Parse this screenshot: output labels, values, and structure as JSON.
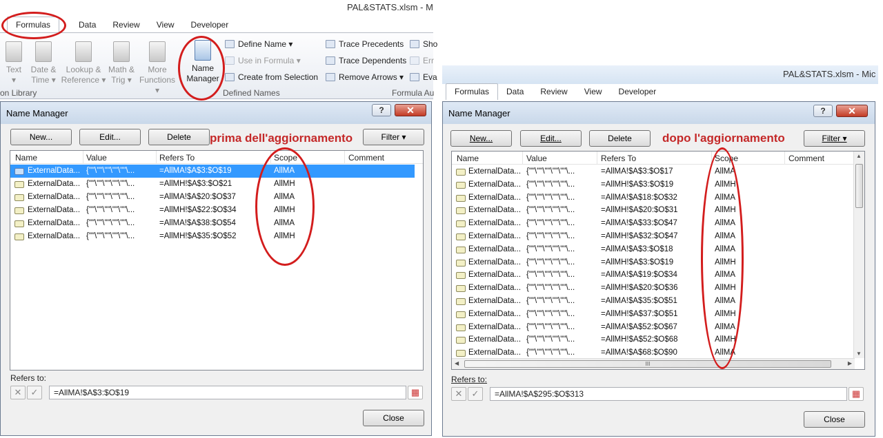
{
  "left": {
    "window_title": "PAL&STATS.xlsm - M",
    "tabs": [
      "Formulas",
      "Data",
      "Review",
      "View",
      "Developer"
    ],
    "ribbon": {
      "function_library": [
        {
          "l1": "Text",
          "l2": "▾"
        },
        {
          "l1": "Date &",
          "l2": "Time ▾"
        },
        {
          "l1": "Lookup &",
          "l2": "Reference ▾"
        },
        {
          "l1": "Math &",
          "l2": "Trig ▾"
        },
        {
          "l1": "More",
          "l2": "Functions ▾"
        }
      ],
      "function_library_label": "on Library",
      "name_manager_l1": "Name",
      "name_manager_l2": "Manager",
      "define_name": "Define Name ▾",
      "use_in_formula": "Use in Formula ▾",
      "create_from_selection": "Create from Selection",
      "defined_names_label": "Defined Names",
      "trace_precedents": "Trace Precedents",
      "trace_dependents": "Trace Dependents",
      "remove_arrows": "Remove Arrows ▾",
      "show": "Sho",
      "error": "Err",
      "evaluate": "Eva",
      "formula_auditing_label": "Formula Au"
    },
    "dialog": {
      "title": "Name Manager",
      "help": "?",
      "close_x": "✕",
      "new": "New...",
      "edit": "Edit...",
      "delete": "Delete",
      "filter": "Filter ▾",
      "annotation": "prima dell'aggiornamento",
      "columns": [
        "Name",
        "Value",
        "Refers To",
        "Scope",
        "Comment"
      ],
      "rows": [
        {
          "name": "ExternalData...",
          "value": "{\"\"\\\"\"\\\"\"\\\"\"\\\"\"\\...",
          "refers": "=AllMA!$A$3:$O$19",
          "scope": "AllMA"
        },
        {
          "name": "ExternalData...",
          "value": "{\"\"\\\"\"\\\"\"\\\"\"\\\"\"\\...",
          "refers": "=AllMH!$A$3:$O$21",
          "scope": "AllMH"
        },
        {
          "name": "ExternalData...",
          "value": "{\"\"\\\"\"\\\"\"\\\"\"\\\"\"\\...",
          "refers": "=AllMA!$A$20:$O$37",
          "scope": "AllMA"
        },
        {
          "name": "ExternalData...",
          "value": "{\"\"\\\"\"\\\"\"\\\"\"\\\"\"\\...",
          "refers": "=AllMH!$A$22:$O$34",
          "scope": "AllMH"
        },
        {
          "name": "ExternalData...",
          "value": "{\"\"\\\"\"\\\"\"\\\"\"\\\"\"\\...",
          "refers": "=AllMA!$A$38:$O$54",
          "scope": "AllMA"
        },
        {
          "name": "ExternalData...",
          "value": "{\"\"\\\"\"\\\"\"\\\"\"\\\"\"\\...",
          "refers": "=AllMH!$A$35:$O$52",
          "scope": "AllMH"
        }
      ],
      "refers_to_label": "Refers to:",
      "refers_to_value": "=AllMA!$A$3:$O$19",
      "close_button": "Close"
    }
  },
  "right": {
    "window_title": "PAL&STATS.xlsm - Mic",
    "tabs": [
      "Formulas",
      "Data",
      "Review",
      "View",
      "Developer"
    ],
    "dialog": {
      "title": "Name Manager",
      "help": "?",
      "close_x": "✕",
      "new": "New...",
      "edit": "Edit...",
      "delete": "Delete",
      "filter": "Filter ▾",
      "annotation": "dopo l'aggiornamento",
      "columns": [
        "Name",
        "Value",
        "Refers To",
        "Scope",
        "Comment"
      ],
      "rows": [
        {
          "name": "ExternalData...",
          "value": "{\"\"\\\"\"\\\"\"\\\"\"\\\"\"\\...",
          "refers": "=AllMA!$A$3:$O$17",
          "scope": "AllMA"
        },
        {
          "name": "ExternalData...",
          "value": "{\"\"\\\"\"\\\"\"\\\"\"\\\"\"\\...",
          "refers": "=AllMH!$A$3:$O$19",
          "scope": "AllMH"
        },
        {
          "name": "ExternalData...",
          "value": "{\"\"\\\"\"\\\"\"\\\"\"\\\"\"\\...",
          "refers": "=AllMA!$A$18:$O$32",
          "scope": "AllMA"
        },
        {
          "name": "ExternalData...",
          "value": "{\"\"\\\"\"\\\"\"\\\"\"\\\"\"\\...",
          "refers": "=AllMH!$A$20:$O$31",
          "scope": "AllMH"
        },
        {
          "name": "ExternalData...",
          "value": "{\"\"\\\"\"\\\"\"\\\"\"\\\"\"\\...",
          "refers": "=AllMA!$A$33:$O$47",
          "scope": "AllMA"
        },
        {
          "name": "ExternalData...",
          "value": "{\"\"\\\"\"\\\"\"\\\"\"\\\"\"\\...",
          "refers": "=AllMH!$A$32:$O$47",
          "scope": "AllMA"
        },
        {
          "name": "ExternalData...",
          "value": "{\"\"\\\"\"\\\"\"\\\"\"\\\"\"\\...",
          "refers": "=AllMA!$A$3:$O$18",
          "scope": "AllMA"
        },
        {
          "name": "ExternalData...",
          "value": "{\"\"\\\"\"\\\"\"\\\"\"\\\"\"\\...",
          "refers": "=AllMH!$A$3:$O$19",
          "scope": "AllMH"
        },
        {
          "name": "ExternalData...",
          "value": "{\"\"\\\"\"\\\"\"\\\"\"\\\"\"\\...",
          "refers": "=AllMA!$A$19:$O$34",
          "scope": "AllMA"
        },
        {
          "name": "ExternalData...",
          "value": "{\"\"\\\"\"\\\"\"\\\"\"\\\"\"\\...",
          "refers": "=AllMH!$A$20:$O$36",
          "scope": "AllMH"
        },
        {
          "name": "ExternalData...",
          "value": "{\"\"\\\"\"\\\"\"\\\"\"\\\"\"\\...",
          "refers": "=AllMA!$A$35:$O$51",
          "scope": "AllMA"
        },
        {
          "name": "ExternalData...",
          "value": "{\"\"\\\"\"\\\"\"\\\"\"\\\"\"\\...",
          "refers": "=AllMH!$A$37:$O$51",
          "scope": "AllMH"
        },
        {
          "name": "ExternalData...",
          "value": "{\"\"\\\"\"\\\"\"\\\"\"\\\"\"\\...",
          "refers": "=AllMA!$A$52:$O$67",
          "scope": "AllMA"
        },
        {
          "name": "ExternalData...",
          "value": "{\"\"\\\"\"\\\"\"\\\"\"\\\"\"\\...",
          "refers": "=AllMH!$A$52:$O$68",
          "scope": "AllMH"
        },
        {
          "name": "ExternalData...",
          "value": "{\"\"\\\"\"\\\"\"\\\"\"\\\"\"\\...",
          "refers": "=AllMA!$A$68:$O$90",
          "scope": "AllMA"
        }
      ],
      "hscroll_grip": "III",
      "refers_to_label": "Refers to:",
      "refers_to_value": "=AllMA!$A$295:$O$313",
      "close_button": "Close"
    }
  },
  "colors": {
    "annotation_red": "#d31d1d",
    "selection": "#3399ff"
  }
}
